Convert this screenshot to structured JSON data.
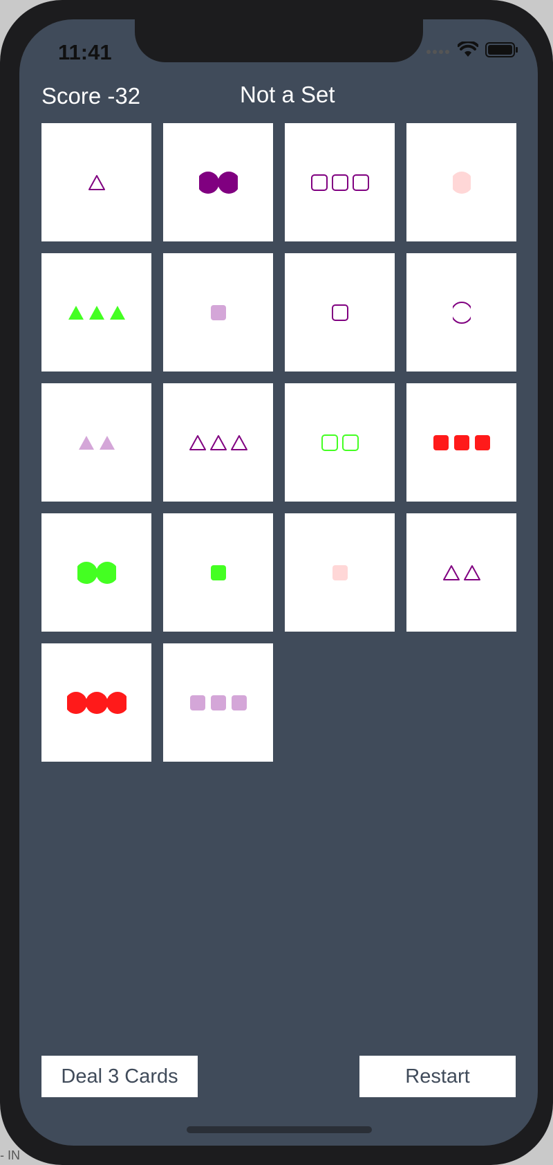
{
  "status_bar": {
    "time": "11:41",
    "icons": [
      "signal-icon",
      "wifi-icon",
      "battery-icon"
    ]
  },
  "header": {
    "score_label": "Score -32",
    "message": "Not a Set"
  },
  "colors": {
    "background": "#404b5a",
    "card": "#ffffff",
    "purple": "#800080",
    "green": "#44ff22",
    "red": "#ff1a1a",
    "lilac": "#d4a6d8",
    "pink": "#ffd7d7"
  },
  "cards": [
    {
      "shape": "triangle",
      "count": 1,
      "color": "#800080",
      "fill": "outline"
    },
    {
      "shape": "circle",
      "count": 2,
      "color": "#800080",
      "fill": "solid"
    },
    {
      "shape": "square",
      "count": 3,
      "color": "#800080",
      "fill": "outline"
    },
    {
      "shape": "circle",
      "count": 1,
      "color": "#ffd7d7",
      "fill": "solid"
    },
    {
      "shape": "triangle",
      "count": 3,
      "color": "#44ff22",
      "fill": "solid"
    },
    {
      "shape": "square",
      "count": 1,
      "color": "#d4a6d8",
      "fill": "solid"
    },
    {
      "shape": "square",
      "count": 1,
      "color": "#800080",
      "fill": "outline"
    },
    {
      "shape": "circle",
      "count": 1,
      "color": "#800080",
      "fill": "outline"
    },
    {
      "shape": "triangle",
      "count": 2,
      "color": "#d4a6d8",
      "fill": "solid"
    },
    {
      "shape": "triangle",
      "count": 3,
      "color": "#800080",
      "fill": "outline"
    },
    {
      "shape": "square",
      "count": 2,
      "color": "#44ff22",
      "fill": "outline"
    },
    {
      "shape": "square",
      "count": 3,
      "color": "#ff1a1a",
      "fill": "solid"
    },
    {
      "shape": "circle",
      "count": 2,
      "color": "#44ff22",
      "fill": "solid"
    },
    {
      "shape": "square",
      "count": 1,
      "color": "#44ff22",
      "fill": "solid"
    },
    {
      "shape": "square",
      "count": 1,
      "color": "#ffd7d7",
      "fill": "solid"
    },
    {
      "shape": "triangle",
      "count": 2,
      "color": "#800080",
      "fill": "outline"
    },
    {
      "shape": "circle",
      "count": 3,
      "color": "#ff1a1a",
      "fill": "solid"
    },
    {
      "shape": "square",
      "count": 3,
      "color": "#d4a6d8",
      "fill": "solid"
    }
  ],
  "buttons": {
    "deal": "Deal 3 Cards",
    "restart": "Restart"
  },
  "corner_text": "- IN"
}
